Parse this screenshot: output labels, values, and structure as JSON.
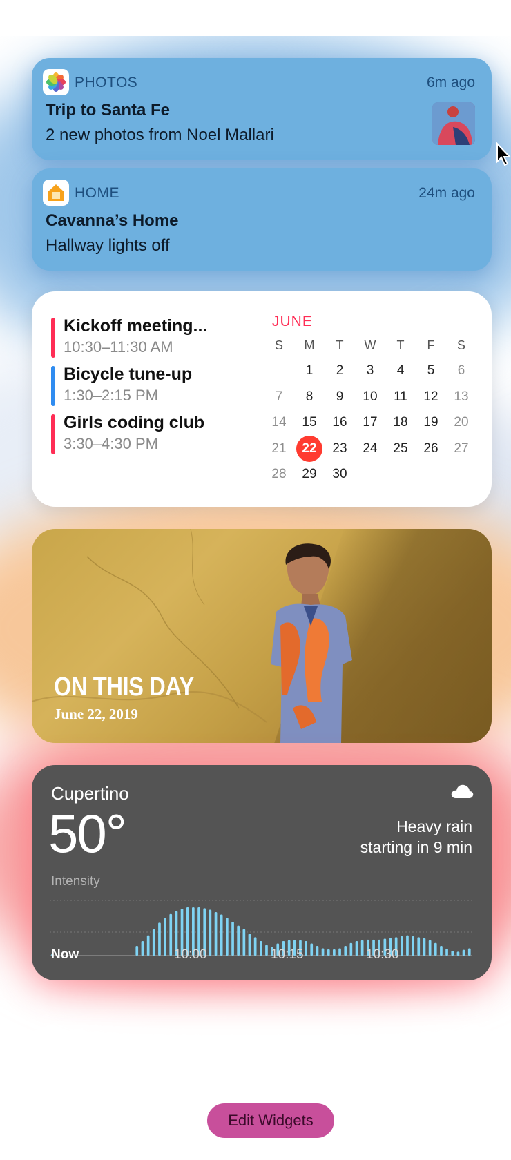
{
  "notifications": [
    {
      "app": "PHOTOS",
      "time": "6m ago",
      "title": "Trip to Santa Fe",
      "body": "2 new photos from Noel Mallari",
      "icon": "photos-app-icon"
    },
    {
      "app": "HOME",
      "time": "24m ago",
      "title": "Cavanna’s Home",
      "body": "Hallway lights off",
      "icon": "home-app-icon"
    }
  ],
  "calendar": {
    "events": [
      {
        "name": "Kickoff meeting...",
        "time": "10:30–11:30 AM",
        "color": "#ff2d55"
      },
      {
        "name": "Bicycle tune-up",
        "time": "1:30–2:15 PM",
        "color": "#2f8cf0"
      },
      {
        "name": "Girls coding club",
        "time": "3:30–4:30 PM",
        "color": "#ff2d55"
      }
    ],
    "month": "JUNE",
    "weekdays": [
      "S",
      "M",
      "T",
      "W",
      "T",
      "F",
      "S"
    ],
    "weeks": [
      [
        "",
        "1",
        "2",
        "3",
        "4",
        "5",
        "6"
      ],
      [
        "7",
        "8",
        "9",
        "10",
        "11",
        "12",
        "13"
      ],
      [
        "14",
        "15",
        "16",
        "17",
        "18",
        "19",
        "20"
      ],
      [
        "21",
        "22",
        "23",
        "24",
        "25",
        "26",
        "27"
      ],
      [
        "28",
        "29",
        "30",
        "",
        "",
        "",
        ""
      ]
    ],
    "today": "22",
    "today_color": "#ff3b30"
  },
  "photo_widget": {
    "caption": "ON THIS DAY",
    "date": "June 22, 2019"
  },
  "weather": {
    "city": "Cupertino",
    "temperature": "50°",
    "condition_line1": "Heavy rain",
    "condition_line2": "starting in 9 min",
    "icon": "cloud-icon",
    "intensity_label": "Intensity",
    "ticks": [
      "Now",
      "10:00",
      "10:15",
      "10:30"
    ],
    "bar_color": "#7fd3f3"
  },
  "chart_data": {
    "type": "bar",
    "title": "",
    "xlabel": "",
    "ylabel": "Intensity",
    "x_ticks": [
      "Now",
      "10:00",
      "10:15",
      "10:30"
    ],
    "ylim": [
      0,
      1
    ],
    "values": [
      0.02,
      0,
      0,
      0,
      0,
      0,
      0,
      0,
      0,
      0,
      0,
      0,
      0,
      0,
      0,
      0.2,
      0.3,
      0.42,
      0.55,
      0.68,
      0.78,
      0.86,
      0.92,
      0.97,
      1.0,
      1.0,
      1.0,
      0.98,
      0.95,
      0.9,
      0.85,
      0.78,
      0.7,
      0.62,
      0.55,
      0.45,
      0.38,
      0.3,
      0.22,
      0.18,
      0.25,
      0.3,
      0.32,
      0.32,
      0.32,
      0.3,
      0.25,
      0.2,
      0.15,
      0.13,
      0.13,
      0.15,
      0.2,
      0.26,
      0.3,
      0.32,
      0.33,
      0.33,
      0.33,
      0.35,
      0.36,
      0.38,
      0.4,
      0.42,
      0.4,
      0.38,
      0.36,
      0.32,
      0.26,
      0.2,
      0.14,
      0.1,
      0.08,
      0.12,
      0.15
    ]
  },
  "edit_button": {
    "label": "Edit Widgets",
    "color": "#c84f9b"
  }
}
